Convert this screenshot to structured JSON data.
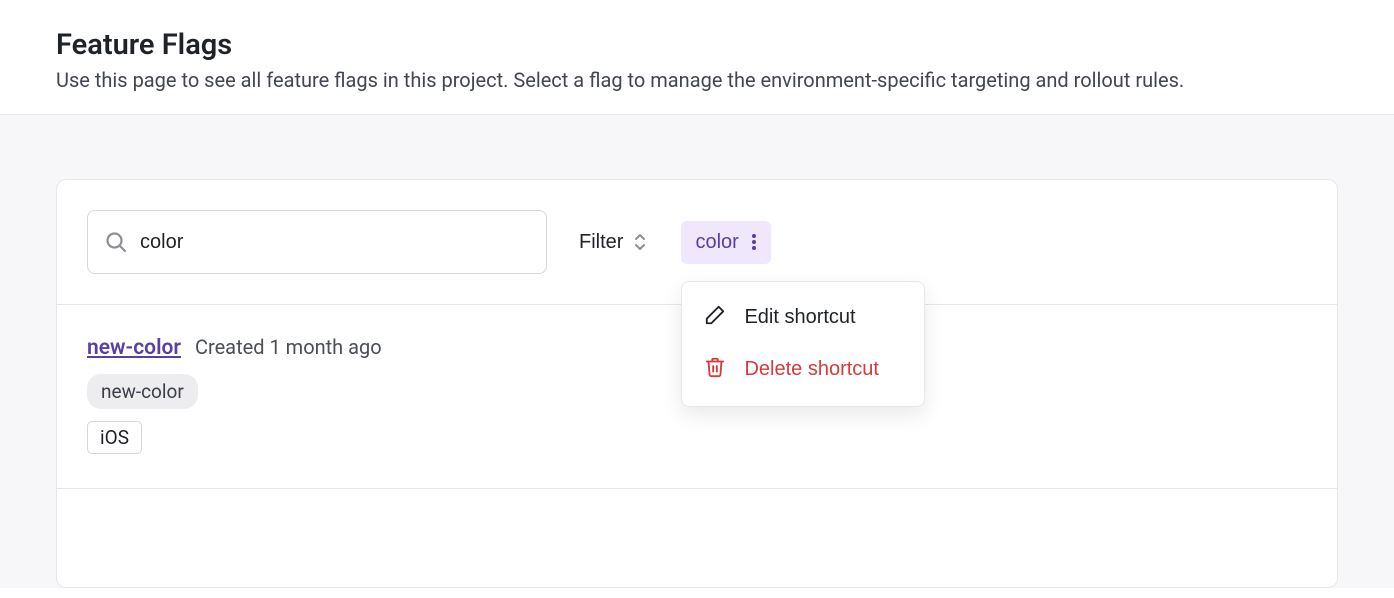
{
  "header": {
    "title": "Feature Flags",
    "subtitle": "Use this page to see all feature flags in this project. Select a flag to manage the environment-specific targeting and rollout rules."
  },
  "toolbar": {
    "search_value": "color",
    "filter_label": "Filter",
    "chip_label": "color",
    "dropdown": {
      "edit_label": "Edit shortcut",
      "delete_label": "Delete shortcut"
    }
  },
  "flags": [
    {
      "name": "new-color",
      "meta": "Created 1 month ago",
      "tags_pill": [
        "new-color"
      ],
      "tags_box": [
        "iOS"
      ]
    }
  ]
}
